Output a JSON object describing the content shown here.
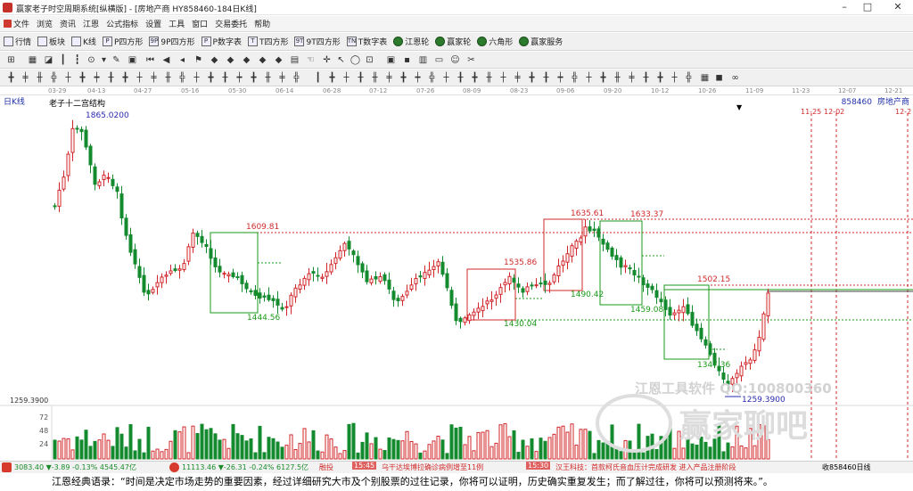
{
  "window": {
    "title": "赢家老子时空周期系统[纵横版] - [房地产商  HY858460-184日K线]",
    "controls": [
      "–",
      "□",
      "✕"
    ]
  },
  "menu": [
    "文件",
    "浏览",
    "资讯",
    "江恩",
    "公式指标",
    "设置",
    "工具",
    "窗口",
    "交易委托",
    "帮助"
  ],
  "toolbar1": [
    {
      "label": "行情",
      "icon": "grid-icon"
    },
    {
      "label": "板块",
      "icon": "blocks-icon"
    },
    {
      "label": "K线",
      "icon": "candle-icon"
    },
    {
      "label": "P四方形",
      "icon": "square-icon",
      "tag": "P"
    },
    {
      "label": "9P四方形",
      "icon": "square-icon",
      "tag": "9P"
    },
    {
      "label": "P数字表",
      "icon": "table-icon",
      "tag": "P"
    },
    {
      "label": "T四方形",
      "icon": "square-icon",
      "tag": "T"
    },
    {
      "label": "9T四方形",
      "icon": "square-icon",
      "tag": "9T"
    },
    {
      "label": "T数字表",
      "icon": "table-icon",
      "tag": "TN"
    },
    {
      "label": "江恩轮",
      "icon": "wheel-icon"
    },
    {
      "label": "赢家轮",
      "icon": "wheel-icon"
    },
    {
      "label": "六角形",
      "icon": "hexagon-icon"
    },
    {
      "label": "赢家服务",
      "icon": "service-icon"
    }
  ],
  "time_axis": [
    "03-29",
    "04-13",
    "04-27",
    "05-16",
    "05-30",
    "06-14",
    "06-28",
    "07-12",
    "07-26",
    "08-09",
    "08-23",
    "09-06",
    "09-20",
    "10-12",
    "10-26",
    "11-09",
    "11-23",
    "12-07",
    "12-21"
  ],
  "chart": {
    "period_label": "日K线",
    "structure_label": "老子十二宫结构",
    "code": "858460",
    "name": "房地产商",
    "high_label": "1865.0200",
    "low_label": "1259.3900",
    "left_price": "1259.3900",
    "date_labels": [
      "11-25",
      "12-02",
      "12-2"
    ],
    "levels": [
      "1609.81",
      "1444.56",
      "1535.86",
      "1430.04",
      "1635.61",
      "1633.37",
      "1490.42",
      "1459.08",
      "1502.15",
      "1347.36"
    ],
    "volume_ticks": [
      "72",
      "48",
      "24"
    ],
    "colors": {
      "up": "#d1262a",
      "down": "#138a2e",
      "box_green": "#1a9a1a",
      "box_red": "#d02a2a",
      "text_blue": "#2a2ab0"
    }
  },
  "watermark": {
    "contact": "江恩工具软件 QQ:100800360",
    "brand": "赢家聊吧"
  },
  "status": {
    "sh_index": "3083.40 ▼-3.89 -0.13% 4545.47亿",
    "sz_index": "11113.46 ▼-26.31 -0.24% 6127.5亿",
    "ticker_a": "融投",
    "time_a": "15:45",
    "news_a": "乌干达埃博拉确诊病例增至11例",
    "time_b": "15:30",
    "news_b": "汉王科技：首款柯氏音血压计完成研发 进入产品注册阶段",
    "right": "收858460日线"
  },
  "quote": "江恩经典语录：“时间是决定市场走势的重要因素，经过详细研究大市及个别股票的过往记录，你将可以证明，历史确实重复发生；而了解过往，你将可以预测将来。”。"
}
